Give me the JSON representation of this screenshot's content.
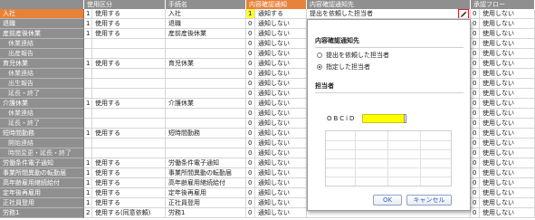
{
  "header": {
    "col_name": "",
    "col_usage": "使用区分",
    "col_form": "手続名",
    "col_confirm": "内容確認通知",
    "col_target": "内容確認通知先",
    "col_approval": "承認フロー"
  },
  "rows": [
    {
      "name": "入社",
      "sub": false,
      "selected": true,
      "num": "1",
      "usage": "使用する",
      "form": "入社",
      "cnum": "1",
      "cval": "通知する",
      "target": "提出を依頼した担当者",
      "edit": true,
      "anum": "0",
      "aval": "使用しない"
    },
    {
      "name": "退職",
      "sub": false,
      "num": "1",
      "usage": "使用する",
      "form": "退職",
      "cnum": "0",
      "cval": "通知しない",
      "anum": "0",
      "aval": "使用しない"
    },
    {
      "name": "産前産後休業",
      "sub": false,
      "num": "1",
      "usage": "使用する",
      "form": "産前産後休業",
      "cnum": "0",
      "cval": "通知しない",
      "anum": "0",
      "aval": "使用しない"
    },
    {
      "name": "休業連絡",
      "sub": true,
      "num": "",
      "usage": "",
      "form": "",
      "cnum": "0",
      "cval": "通知しない",
      "anum": "0",
      "aval": "使用しない"
    },
    {
      "name": "出産報告",
      "sub": true,
      "num": "",
      "usage": "",
      "form": "",
      "cnum": "0",
      "cval": "通知しない",
      "anum": "0",
      "aval": "使用しない"
    },
    {
      "name": "育児休業",
      "sub": false,
      "num": "1",
      "usage": "使用する",
      "form": "育児休業",
      "cnum": "0",
      "cval": "通知しない",
      "anum": "0",
      "aval": "使用しない"
    },
    {
      "name": "休業連絡",
      "sub": true,
      "num": "",
      "usage": "",
      "form": "",
      "cnum": "0",
      "cval": "通知しない",
      "anum": "0",
      "aval": "使用しない"
    },
    {
      "name": "出生報告",
      "sub": true,
      "num": "",
      "usage": "",
      "form": "",
      "cnum": "0",
      "cval": "通知しない",
      "anum": "0",
      "aval": "使用しない"
    },
    {
      "name": "延長・終了",
      "sub": true,
      "num": "",
      "usage": "",
      "form": "",
      "cnum": "0",
      "cval": "通知しない",
      "anum": "0",
      "aval": "使用しない"
    },
    {
      "name": "介護休業",
      "sub": false,
      "num": "1",
      "usage": "使用する",
      "form": "介護休業",
      "cnum": "0",
      "cval": "通知しない",
      "anum": "0",
      "aval": "使用しない"
    },
    {
      "name": "休業連絡",
      "sub": true,
      "num": "",
      "usage": "",
      "form": "",
      "cnum": "0",
      "cval": "通知しない",
      "anum": "0",
      "aval": "使用しない"
    },
    {
      "name": "延長・終了",
      "sub": true,
      "num": "",
      "usage": "",
      "form": "",
      "cnum": "0",
      "cval": "通知しない",
      "anum": "0",
      "aval": "使用しない"
    },
    {
      "name": "短時間勤務",
      "sub": false,
      "num": "1",
      "usage": "使用する",
      "form": "短時間勤務",
      "cnum": "0",
      "cval": "通知しない",
      "anum": "0",
      "aval": "使用しない"
    },
    {
      "name": "開始連絡",
      "sub": true,
      "num": "",
      "usage": "",
      "form": "",
      "cnum": "0",
      "cval": "通知しない",
      "anum": "0",
      "aval": "使用しない"
    },
    {
      "name": "時間変更・延長・終了",
      "sub": true,
      "num": "",
      "usage": "",
      "form": "",
      "cnum": "0",
      "cval": "通知しない",
      "anum": "0",
      "aval": "使用しない"
    },
    {
      "name": "労働条件電子通知",
      "sub": false,
      "num": "1",
      "usage": "使用する",
      "form": "労働条件電子通知",
      "cnum": "0",
      "cval": "通知しない",
      "anum": "0",
      "aval": "使用しない"
    },
    {
      "name": "事業所間異動の転勤届",
      "sub": false,
      "num": "1",
      "usage": "使用する",
      "form": "事業所間異動の転勤届",
      "cnum": "0",
      "cval": "通知しない",
      "anum": "0",
      "aval": "使用しない"
    },
    {
      "name": "高年齢雇用継続給付",
      "sub": false,
      "num": "1",
      "usage": "使用する",
      "form": "高年齢雇用継続給付",
      "cnum": "0",
      "cval": "通知しない",
      "anum": "0",
      "aval": "使用しない"
    },
    {
      "name": "定年後再雇用",
      "sub": false,
      "num": "1",
      "usage": "使用する",
      "form": "定年後再雇用",
      "cnum": "0",
      "cval": "通知しない",
      "anum": "0",
      "aval": "使用しない"
    },
    {
      "name": "正社員登用",
      "sub": false,
      "num": "1",
      "usage": "使用する",
      "form": "正社員登用",
      "cnum": "0",
      "cval": "通知しない",
      "anum": "0",
      "aval": "使用しない"
    },
    {
      "name": "労務1",
      "sub": false,
      "num": "2",
      "usage": "使用する(同意依頼)",
      "form": "労務1",
      "cnum": "0",
      "cval": "通知しない",
      "anum": "0",
      "aval": "使用しない"
    }
  ],
  "popup": {
    "section1_title": "内容確認通知先",
    "option1_label": "提出を依頼した担当者",
    "option2_label": "指定した担当者",
    "selected_option": "指定した担当者",
    "section2_title": "担当者",
    "id_label": "OBCiD",
    "id_value": "",
    "ok_label": "OK",
    "cancel_label": "キャンセル"
  },
  "colors": {
    "header_gray": "#8f8f8f",
    "accent_orange": "#e8823a",
    "highlight_yellow": "#ffff33",
    "edit_border_red": "#e0161c"
  },
  "icons": {
    "edit": "pencil-icon"
  }
}
